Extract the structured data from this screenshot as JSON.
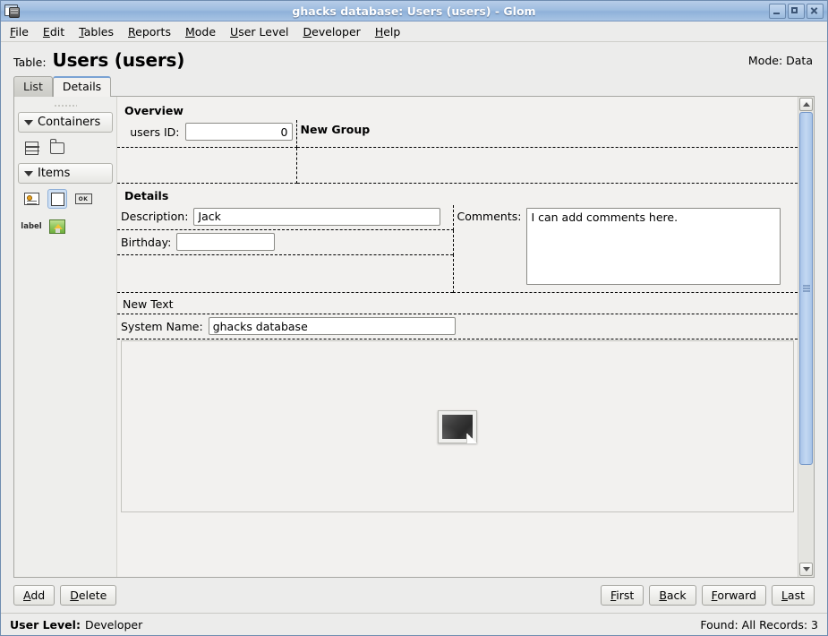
{
  "window": {
    "title": "ghacks database: Users (users) - Glom",
    "icon": "database-window-icon",
    "controls": {
      "minimize": "minimize",
      "maximize": "maximize",
      "close": "close"
    }
  },
  "menubar": {
    "items": [
      {
        "label": "File",
        "mnemonic": "F"
      },
      {
        "label": "Edit",
        "mnemonic": "E"
      },
      {
        "label": "Tables",
        "mnemonic": "T"
      },
      {
        "label": "Reports",
        "mnemonic": "R"
      },
      {
        "label": "Mode",
        "mnemonic": "M"
      },
      {
        "label": "User Level",
        "mnemonic": "U"
      },
      {
        "label": "Developer",
        "mnemonic": "D"
      },
      {
        "label": "Help",
        "mnemonic": "H"
      }
    ]
  },
  "header": {
    "table_label": "Table:",
    "table_title": "Users (users)",
    "mode": "Mode: Data"
  },
  "tabs": [
    {
      "label": "List",
      "active": false
    },
    {
      "label": "Details",
      "active": true
    }
  ],
  "palette": {
    "containers": {
      "label": "Containers",
      "expanded": true,
      "icons": [
        {
          "name": "list-container-icon",
          "title": "List"
        },
        {
          "name": "notebook-container-icon",
          "title": "Notebook"
        }
      ]
    },
    "items": {
      "label": "Items",
      "expanded": true,
      "icons": [
        {
          "name": "field-item-icon",
          "title": "Field"
        },
        {
          "name": "text-item-icon",
          "title": "Text",
          "selected": true
        },
        {
          "name": "button-item-icon",
          "title": "Button",
          "text": "OK"
        },
        {
          "name": "label-item-icon",
          "title": "Label",
          "text": "label"
        },
        {
          "name": "image-item-icon",
          "title": "Image"
        }
      ]
    }
  },
  "detail": {
    "overview": {
      "title": "Overview",
      "users_id_label": "users ID:",
      "users_id_value": "0",
      "new_group_title": "New Group"
    },
    "details": {
      "title": "Details",
      "description_label": "Description:",
      "description_value": "Jack",
      "birthday_label": "Birthday:",
      "birthday_value": "",
      "comments_label": "Comments:",
      "comments_value": "I can add comments here."
    },
    "new_text": {
      "title": "New Text",
      "system_name_label": "System Name:",
      "system_name_value": "ghacks database",
      "image_placeholder": "image-placeholder-icon"
    }
  },
  "scrollbar": {
    "up": "scroll-up",
    "down": "scroll-down",
    "thumb": "scroll-thumb"
  },
  "actions": {
    "add": {
      "label": "Add",
      "mnemonic": "A"
    },
    "delete": {
      "label": "Delete",
      "mnemonic": "D"
    },
    "first": {
      "label": "First",
      "mnemonic": "F"
    },
    "back": {
      "label": "Back",
      "mnemonic": "B"
    },
    "forward": {
      "label": "Forward",
      "mnemonic": "F"
    },
    "last": {
      "label": "Last",
      "mnemonic": "L"
    }
  },
  "statusbar": {
    "user_level_label": "User Level:",
    "user_level_value": "Developer",
    "records": "Found: All Records:  3"
  },
  "colors": {
    "titlebar": "#9fbde0",
    "accent": "#7aa3d4",
    "scroll_thumb": "#a9c4e8",
    "window_bg": "#ececeb",
    "canvas_bg": "#f2f1ef"
  }
}
